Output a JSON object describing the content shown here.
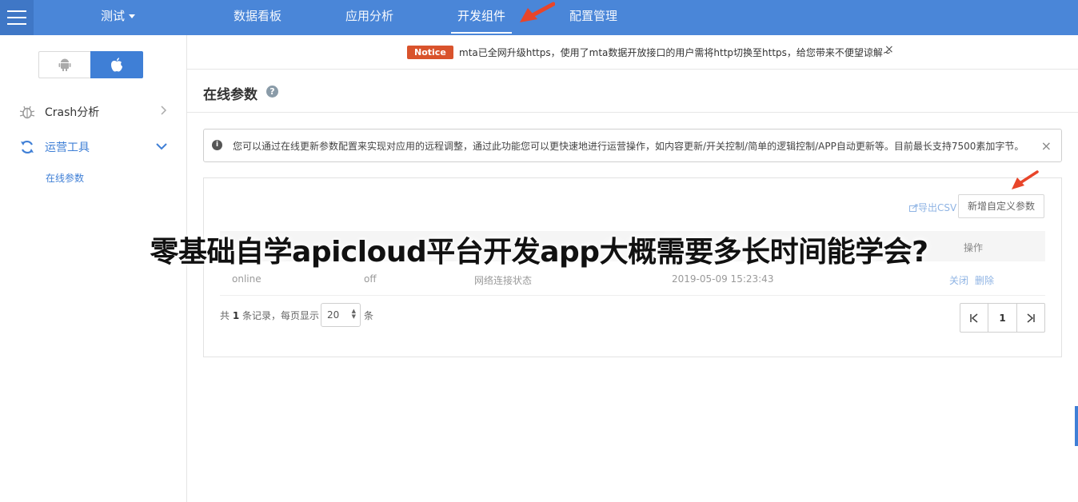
{
  "nav": {
    "project": "测试",
    "tabs": [
      "数据看板",
      "应用分析",
      "开发组件",
      "配置管理"
    ],
    "active_tab": 2
  },
  "sidebar": {
    "items": [
      {
        "label": "Crash分析",
        "icon": "bug-icon"
      },
      {
        "label": "运营工具",
        "icon": "refresh-icon"
      }
    ],
    "sub_item": "在线参数"
  },
  "notice": {
    "badge": "Notice",
    "text": "mta已全网升级https，使用了mta数据开放接口的用户需将http切换至https，给您带来不便望谅解~",
    "close": "×"
  },
  "page": {
    "title": "在线参数",
    "help": "?"
  },
  "info": {
    "icon": "i",
    "text": "您可以通过在线更新参数配置来实现对应用的远程调整，通过此功能您可以更快速地进行运营操作，如内容更新/开关控制/简单的逻辑控制/APP自动更新等。目前最长支持7500素加字节。",
    "close": "×"
  },
  "toolbar": {
    "export": "导出CSV",
    "add": "新增自定义参数"
  },
  "table": {
    "op_header": "操作",
    "rows": [
      {
        "key": "online",
        "value": "off",
        "desc": "网络连接状态",
        "time": "2019-05-09 15:23:43",
        "actions": [
          "关闭",
          "删除"
        ]
      }
    ]
  },
  "pager": {
    "prefix": "共",
    "count": "1",
    "mid": "条记录，每页显示",
    "page_size": "20",
    "suffix": "条",
    "current": "1"
  },
  "overlay_title": "零基础自学apicloud平台开发app大概需要多长时间能学会?",
  "colors": {
    "topbar": "#4a86d8",
    "accent": "#3f7fd6",
    "notice_badge": "#d9532c",
    "arrow": "#e8452a"
  }
}
